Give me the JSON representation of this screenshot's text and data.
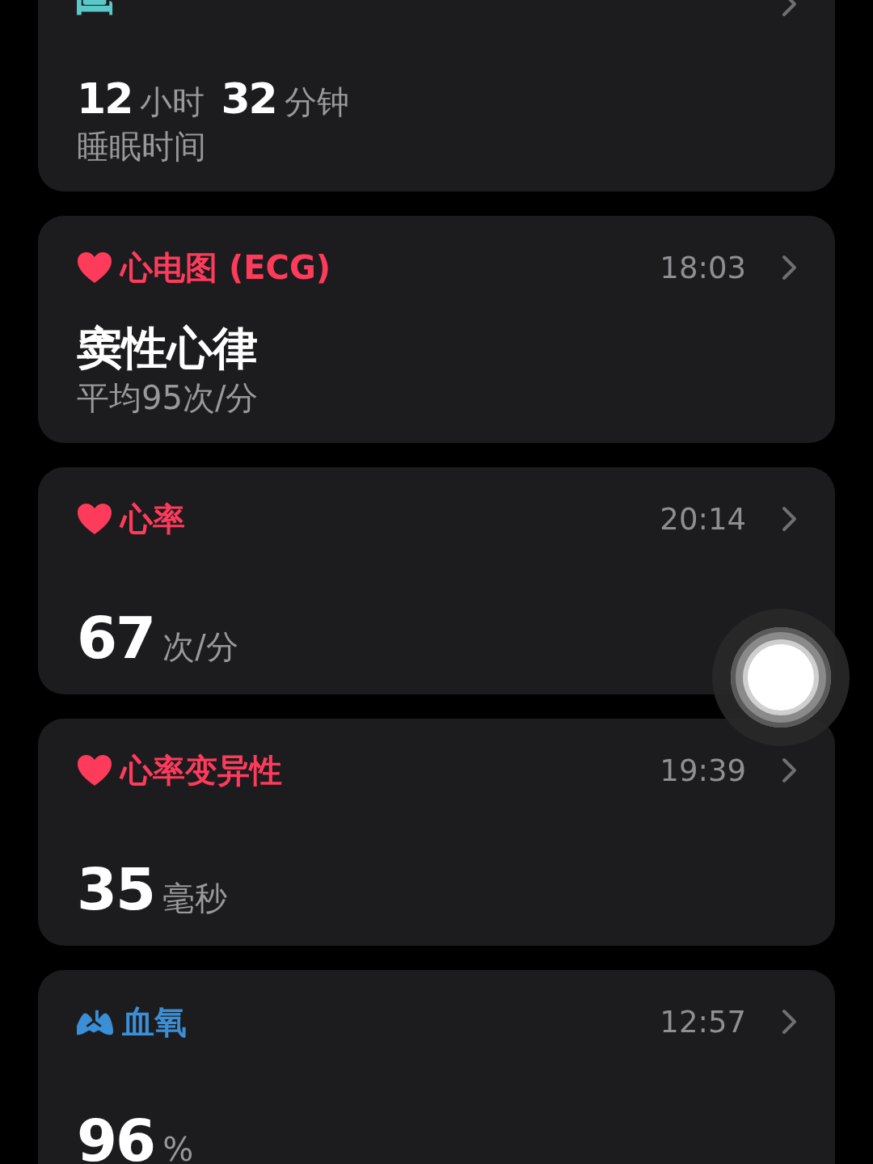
{
  "cards": [
    {
      "kind": "sleep",
      "color": "#5ac8c8",
      "value": [
        {
          "kind": "number",
          "text": "12"
        },
        {
          "kind": "unit",
          "text": "小时"
        },
        {
          "kind": "number",
          "text": "32"
        },
        {
          "kind": "unit",
          "text": "分钟"
        }
      ],
      "subtitle": "睡眠时间"
    },
    {
      "kind": "heart",
      "title": "心电图 (ECG)",
      "color": "#ff3b5c",
      "time": "18:03",
      "headline": "窦性心律",
      "subtitle": "平均95次/分"
    },
    {
      "kind": "heart",
      "title": "心率",
      "color": "#ff3b5c",
      "time": "20:14",
      "value": [
        {
          "kind": "number",
          "text": "67"
        },
        {
          "kind": "unit",
          "text": "次/分"
        }
      ]
    },
    {
      "kind": "heart",
      "title": "心率变异性",
      "color": "#ff3b5c",
      "time": "19:39",
      "value": [
        {
          "kind": "number",
          "text": "35"
        },
        {
          "kind": "unit",
          "text": "毫秒"
        }
      ]
    },
    {
      "kind": "oxygen",
      "title": "血氧",
      "color": "#3a8fd6",
      "time": "12:57",
      "value": [
        {
          "kind": "number",
          "text": "96"
        },
        {
          "kind": "unit",
          "text": "%"
        }
      ]
    }
  ]
}
